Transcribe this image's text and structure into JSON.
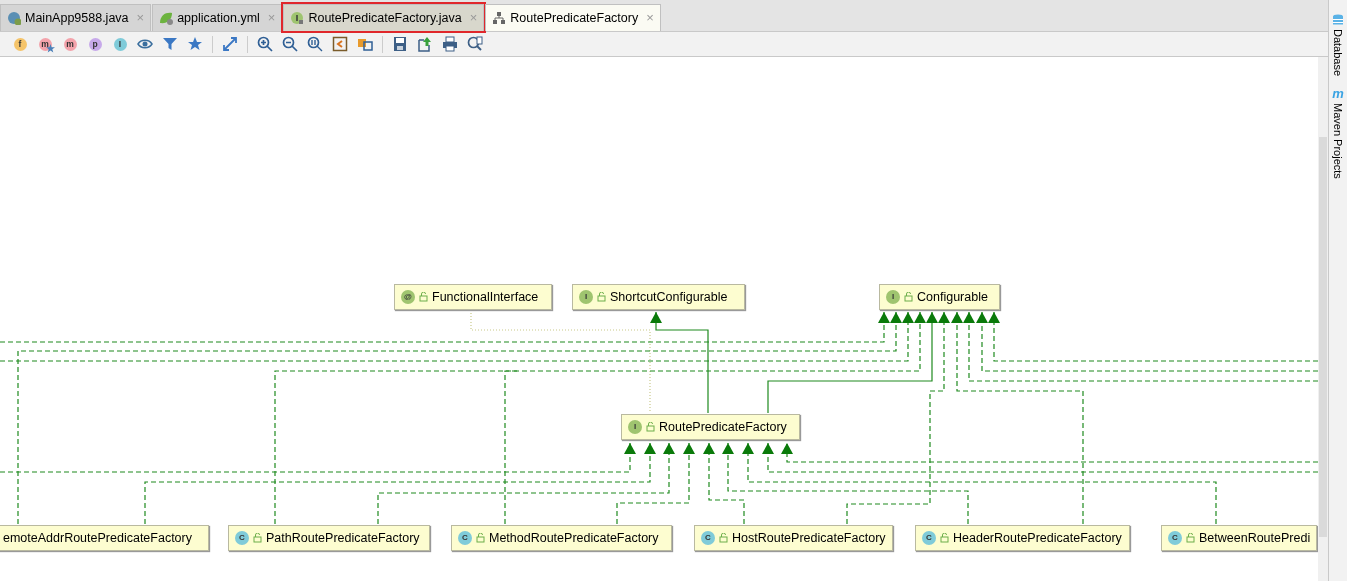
{
  "tabs": [
    {
      "label": "MainApp9588.java",
      "kind": "class",
      "selected": false,
      "outlined": false,
      "close": "×"
    },
    {
      "label": "application.yml",
      "kind": "yml",
      "selected": false,
      "outlined": false,
      "close": "×"
    },
    {
      "label": "RoutePredicateFactory.java",
      "kind": "interface",
      "selected": false,
      "outlined": true,
      "close": "×"
    },
    {
      "label": "RoutePredicateFactory",
      "kind": "diagram",
      "selected": true,
      "outlined": false,
      "close": "×"
    }
  ],
  "toolbar": {
    "letter_buttons": [
      {
        "label": "f",
        "color": "#f5c46a",
        "starred": false
      },
      {
        "label": "m",
        "color": "#f3a3ab",
        "starred": true
      },
      {
        "label": "m",
        "color": "#f3a3ab",
        "starred": false
      },
      {
        "label": "p",
        "color": "#c7a9ea",
        "starred": false
      },
      {
        "label": "I",
        "color": "#7fcbd9",
        "starred": false
      }
    ]
  },
  "side_panel": [
    {
      "label": "Database",
      "kind": "database"
    },
    {
      "label": "Maven Projects",
      "kind": "maven",
      "icon": "m"
    }
  ],
  "diagram": {
    "nodes": [
      {
        "label": "FunctionalInterface",
        "kind": "annotation",
        "badge": "@"
      },
      {
        "label": "ShortcutConfigurable",
        "kind": "interface",
        "badge": "I"
      },
      {
        "label": "Configurable",
        "kind": "interface",
        "badge": "I"
      },
      {
        "label": "RoutePredicateFactory",
        "kind": "interface",
        "badge": "I"
      },
      {
        "label": "emoteAddrRoutePredicateFactory",
        "kind": "class"
      },
      {
        "label": "PathRoutePredicateFactory",
        "kind": "class",
        "badge": "C"
      },
      {
        "label": "MethodRoutePredicateFactory",
        "kind": "class",
        "badge": "C"
      },
      {
        "label": "HostRoutePredicateFactory",
        "kind": "class",
        "badge": "C"
      },
      {
        "label": "HeaderRoutePredicateFactory",
        "kind": "class",
        "badge": "C"
      },
      {
        "label": "BetweenRoutePredi",
        "kind": "class",
        "badge": "C"
      }
    ]
  }
}
